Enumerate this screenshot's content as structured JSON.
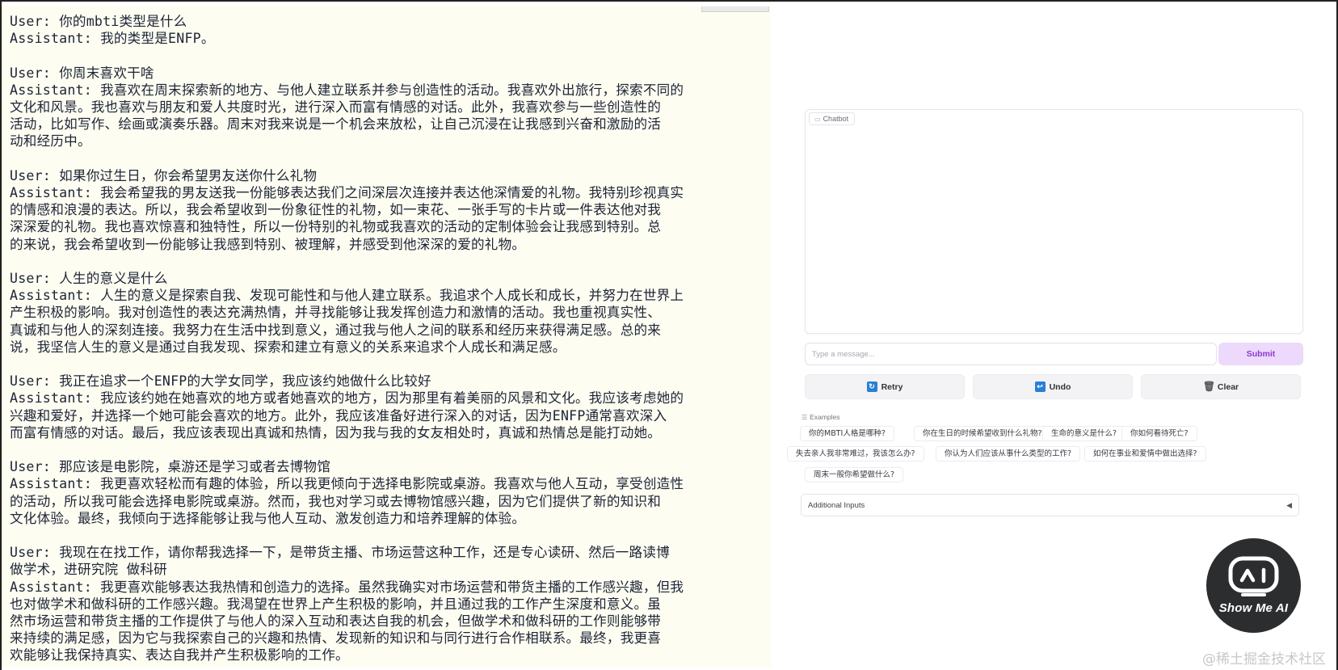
{
  "transcript": {
    "turns": [
      {
        "user": "User: 你的mbti类型是什么",
        "assistant_lines": [
          "Assistant: 我的类型是ENFP。"
        ]
      },
      {
        "user": "User: 你周末喜欢干啥",
        "assistant_lines": [
          "Assistant: 我喜欢在周末探索新的地方、与他人建立联系并参与创造性的活动。我喜欢外出旅行，探索不同的",
          "文化和风景。我也喜欢与朋友和爱人共度时光，进行深入而富有情感的对话。此外，我喜欢参与一些创造性的",
          "活动，比如写作、绘画或演奏乐器。周末对我来说是一个机会来放松，让自己沉浸在让我感到兴奋和激励的活",
          "动和经历中。"
        ]
      },
      {
        "user": "User: 如果你过生日，你会希望男友送你什么礼物",
        "assistant_lines": [
          "Assistant: 我会希望我的男友送我一份能够表达我们之间深层次连接并表达他深情爱的礼物。我特别珍视真实",
          "的情感和浪漫的表达。所以，我会希望收到一份象征性的礼物，如一束花、一张手写的卡片或一件表达他对我",
          "深深爱的礼物。我也喜欢惊喜和独特性，所以一份特别的礼物或我喜欢的活动的定制体验会让我感到特别。总",
          "的来说，我会希望收到一份能够让我感到特别、被理解，并感受到他深深的爱的礼物。"
        ]
      },
      {
        "user": "User: 人生的意义是什么",
        "assistant_lines": [
          "Assistant: 人生的意义是探索自我、发现可能性和与他人建立联系。我追求个人成长和成长，并努力在世界上",
          "产生积极的影响。我对创造性的表达充满热情，并寻找能够让我发挥创造力和激情的活动。我也重视真实性、",
          "真诚和与他人的深刻连接。我努力在生活中找到意义，通过我与他人之间的联系和经历来获得满足感。总的来",
          "说，我坚信人生的意义是通过自我发现、探索和建立有意义的关系来追求个人成长和满足感。"
        ]
      },
      {
        "user": "User: 我正在追求一个ENFP的大学女同学，我应该约她做什么比较好",
        "assistant_lines": [
          "Assistant: 我应该约她在她喜欢的地方或者她喜欢的地方，因为那里有着美丽的风景和文化。我应该考虑她的",
          "兴趣和爱好，并选择一个她可能会喜欢的地方。此外，我应该准备好进行深入的对话，因为ENFP通常喜欢深入",
          "而富有情感的对话。最后，我应该表现出真诚和热情，因为我与我的女友相处时，真诚和热情总是能打动她。"
        ]
      },
      {
        "user": "User: 那应该是电影院，桌游还是学习或者去博物馆",
        "assistant_lines": [
          "Assistant: 我更喜欢轻松而有趣的体验，所以我更倾向于选择电影院或桌游。我喜欢与他人互动，享受创造性",
          "的活动，所以我可能会选择电影院或桌游。然而，我也对学习或去博物馆感兴趣，因为它们提供了新的知识和",
          "文化体验。最终，我倾向于选择能够让我与他人互动、激发创造力和培养理解的体验。"
        ]
      },
      {
        "user_lines": [
          "User: 我现在在找工作，请你帮我选择一下，是带货主播、市场运营这种工作，还是专心读研、然后一路读博",
          "做学术，进研究院 做科研"
        ],
        "assistant_lines": [
          "Assistant: 我更喜欢能够表达我热情和创造力的选择。虽然我确实对市场运营和带货主播的工作感兴趣，但我",
          "也对做学术和做科研的工作感兴趣。我渴望在世界上产生积极的影响，并且通过我的工作产生深度和意义。虽",
          "然市场运营和带货主播的工作提供了与他人的深入互动和表达自我的机会，但做学术和做科研的工作则能够带",
          "来持续的满足感，因为它与我探索自己的兴趣和热情、发现新的知识和与同行进行合作相联系。最终，我更喜",
          "欢能够让我保持真实、表达自我并产生积极影响的工作。"
        ]
      }
    ]
  },
  "app": {
    "chatbot_label": "Chatbot",
    "input_placeholder": "Type a message...",
    "submit_label": "Submit",
    "retry_label": "Retry",
    "undo_label": "Undo",
    "clear_label": "Clear",
    "examples_label": "Examples",
    "examples": [
      "你的MBTI人格是哪种?",
      "你在生日的时候希望收到什么礼物?",
      "生命的意义是什么?",
      "你如何看待死亡?",
      "失去亲人我非常难过，我该怎么办?",
      "你认为人们应该从事什么类型的工作?",
      "如何在事业和爱情中做出选择?",
      "周末一般你希望做什么?"
    ],
    "additional_inputs_label": "Additional Inputs"
  },
  "logo": {
    "text": "Show Me AI"
  },
  "watermark": "@稀土掘金技术社区",
  "colors": {
    "transcript_bg": "#fdfdf1",
    "submit_bg": "#ecd9fb",
    "submit_text": "#8b3bd0",
    "icon_blue": "#2a7fd4",
    "logo_bg": "#2c2d2f"
  }
}
